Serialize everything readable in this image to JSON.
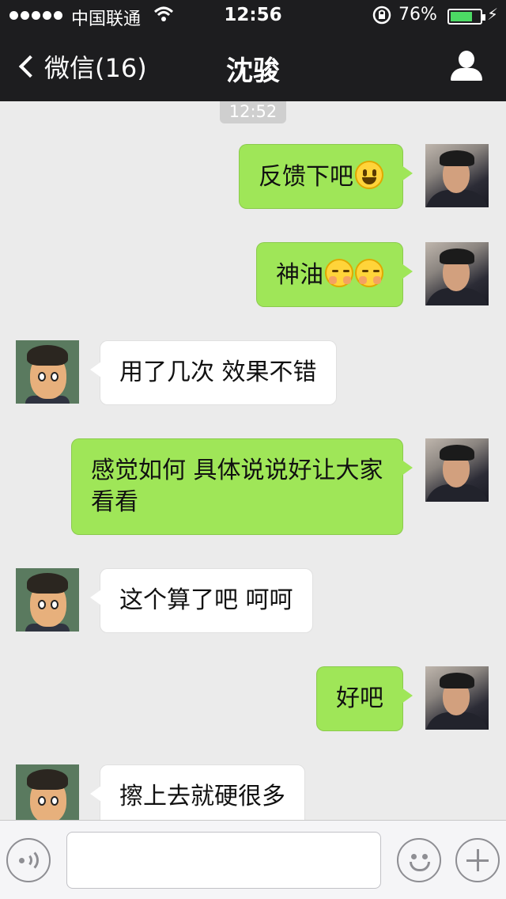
{
  "status_bar": {
    "carrier": "中国联通",
    "time": "12:56",
    "battery_percent": "76%",
    "battery_level": 0.76,
    "icons": [
      "signal-dots-icon",
      "wifi-icon",
      "orientation-lock-icon",
      "battery-icon",
      "charging-bolt-icon"
    ]
  },
  "nav": {
    "back_label": "微信(16)",
    "title": "沈骏",
    "right_icon": "profile-icon"
  },
  "chat": {
    "timestamp": "12:52",
    "messages": [
      {
        "from": "me",
        "text": "反馈下吧",
        "emoji": [
          "smiley"
        ]
      },
      {
        "from": "me",
        "text": "神油",
        "emoji": [
          "blush",
          "blush"
        ]
      },
      {
        "from": "other",
        "text": "用了几次 效果不错"
      },
      {
        "from": "me",
        "text": "感觉如何 具体说说好让大家看看"
      },
      {
        "from": "other",
        "text": "这个算了吧 呵呵"
      },
      {
        "from": "me",
        "text": "好吧"
      },
      {
        "from": "other",
        "text": "擦上去就硬很多"
      }
    ]
  },
  "input_bar": {
    "value": "",
    "icons": [
      "voice-icon",
      "emoji-icon",
      "plus-icon"
    ]
  },
  "colors": {
    "nav_bg": "#1d1d1f",
    "chat_bg": "#ebebeb",
    "outgoing_bubble": "#9fe658",
    "incoming_bubble": "#ffffff"
  }
}
